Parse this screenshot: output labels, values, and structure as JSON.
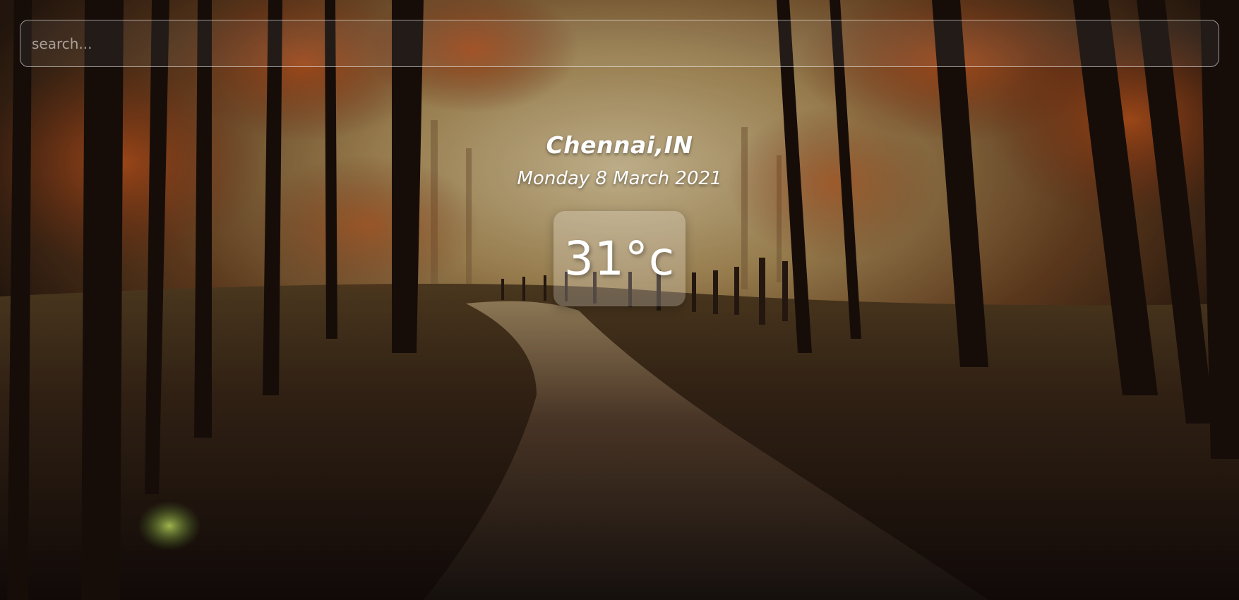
{
  "search": {
    "placeholder": "search...",
    "value": ""
  },
  "weather": {
    "location": "Chennai,IN",
    "date": "Monday 8 March 2021",
    "temperature": "31°c"
  },
  "background": {
    "description_icon": "autumn-forest-path-background",
    "colors": {
      "sky": "#b9a27a",
      "foliage": "#8a3e16",
      "shadow": "#1b1310"
    }
  }
}
